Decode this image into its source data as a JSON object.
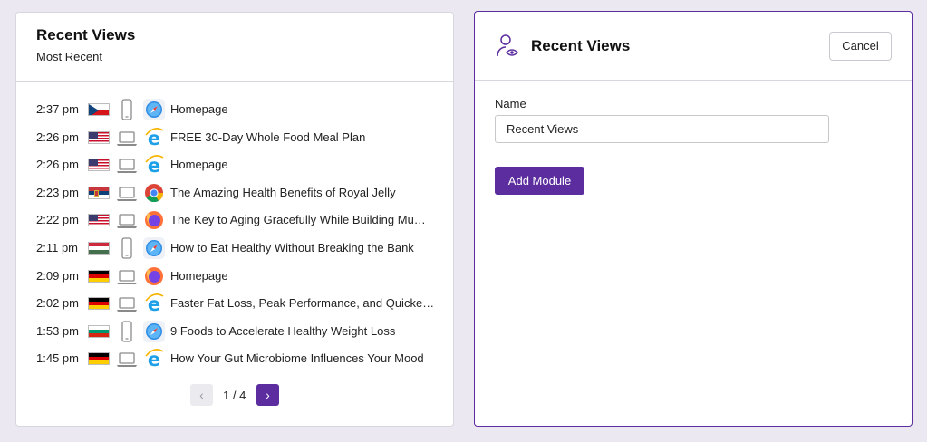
{
  "recent_views": {
    "title": "Recent Views",
    "subtitle": "Most Recent",
    "rows": [
      {
        "time": "2:37 pm",
        "flag": "czech",
        "device": "phone-icon",
        "browser": "safari-icon",
        "page": "Homepage"
      },
      {
        "time": "2:26 pm",
        "flag": "usa",
        "device": "laptop-icon",
        "browser": "ie-icon",
        "page": "FREE 30-Day Whole Food Meal Plan"
      },
      {
        "time": "2:26 pm",
        "flag": "usa",
        "device": "laptop-icon",
        "browser": "ie-icon",
        "page": "Homepage"
      },
      {
        "time": "2:23 pm",
        "flag": "serbia",
        "device": "laptop-icon",
        "browser": "chrome-icon",
        "page": "The Amazing Health Benefits of Royal Jelly"
      },
      {
        "time": "2:22 pm",
        "flag": "usa",
        "device": "laptop-icon",
        "browser": "firefox-icon",
        "page": "The Key to Aging Gracefully While Building Mu…"
      },
      {
        "time": "2:11 pm",
        "flag": "hungary",
        "device": "phone-icon",
        "browser": "safari-icon",
        "page": "How to Eat Healthy Without Breaking the Bank"
      },
      {
        "time": "2:09 pm",
        "flag": "germany",
        "device": "laptop-icon",
        "browser": "firefox-icon",
        "page": "Homepage"
      },
      {
        "time": "2:02 pm",
        "flag": "germany",
        "device": "laptop-icon",
        "browser": "ie-icon",
        "page": "Faster Fat Loss, Peak Performance, and Quicke…"
      },
      {
        "time": "1:53 pm",
        "flag": "bulgaria",
        "device": "phone-icon",
        "browser": "safari-icon",
        "page": "9 Foods to Accelerate Healthy Weight Loss"
      },
      {
        "time": "1:45 pm",
        "flag": "germany",
        "device": "laptop-icon",
        "browser": "ie-icon",
        "page": "How Your Gut Microbiome Influences Your Mood"
      }
    ],
    "pager": {
      "prev_icon": "chevron-left-icon",
      "label": "1 / 4",
      "next_icon": "chevron-right-icon"
    }
  },
  "module_editor": {
    "title": "Recent Views",
    "icon": "user-eye-icon",
    "cancel_label": "Cancel",
    "name_label": "Name",
    "name_value": "Recent Views",
    "add_label": "Add Module"
  },
  "colors": {
    "accent": "#5b2d9e",
    "background": "#ebe8f1"
  }
}
